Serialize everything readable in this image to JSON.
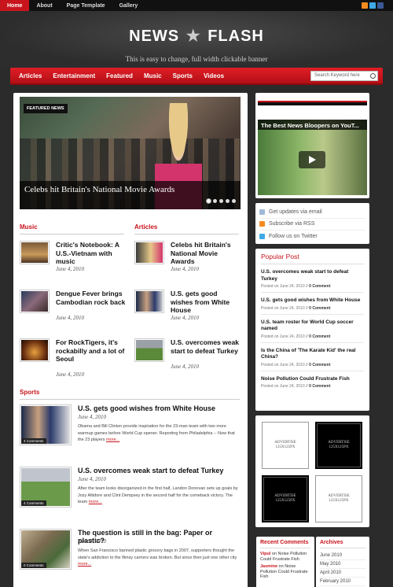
{
  "topnav": {
    "items": [
      "Home",
      "About",
      "Page Template",
      "Gallery"
    ],
    "social": [
      {
        "name": "rss-icon",
        "color": "#f58b1f"
      },
      {
        "name": "twitter-icon",
        "color": "#3fa9e6"
      },
      {
        "name": "facebook-icon",
        "color": "#3b5998"
      }
    ]
  },
  "header": {
    "logo_left": "NEWS",
    "logo_right": "FLASH",
    "tagline": "This is easy to change, full width clickable banner"
  },
  "menu": {
    "items": [
      "Articles",
      "Entertainment",
      "Featured",
      "Music",
      "Sports",
      "Videos"
    ],
    "search_placeholder": "Search Keyword here"
  },
  "featured": {
    "label": "FEATURED NEWS",
    "caption": "Celebs hit Britain's National Movie Awards"
  },
  "music": {
    "title": "Music",
    "items": [
      {
        "title": "Critic's Notebook: A U.S.-Vietnam with music",
        "date": "June 4, 2010"
      },
      {
        "title": "Dengue Fever brings Cambodian rock back",
        "date": "June 4, 2010"
      },
      {
        "title": "For RockTigers, it's rockabilly and a lot of Seoul",
        "date": "June 4, 2010"
      }
    ]
  },
  "articles": {
    "title": "Articles",
    "items": [
      {
        "title": "Celebs hit Britain's National Movie Awards",
        "date": "June 4, 2010"
      },
      {
        "title": "U.S. gets good wishes from White House",
        "date": "June 4, 2010"
      },
      {
        "title": "U.S. overcomes weak start to defeat Turkey",
        "date": "June 4, 2010"
      }
    ]
  },
  "sports": {
    "title": "Sports",
    "items": [
      {
        "title": "U.S. gets good wishes from White House",
        "date": "June 4, 2010",
        "comments": "4 Comments",
        "excerpt": "Obama and Bill Clinton provide inspiration for the 23-man team with two more warmup games before World Cup opener. Reporting from Philadelphia -- Now that the 23 players",
        "more": "more..."
      },
      {
        "title": "U.S. overcomes weak start to defeat Turkey",
        "date": "June 4, 2010",
        "comments": "4 Comments",
        "excerpt": "After the team looks disorganized in the first half, Landon Donovan sets up goals by Jozy Altidore and Clint Dempsey in the second half for the comeback victory. The team",
        "more": "more..."
      },
      {
        "title": "The question is still in the bag: Paper or plastic?",
        "date": "June 4, 2010",
        "comments": "0 Comments",
        "excerpt": "When San Francisco banned plastic grocery bags in 2007, supporters thought the state's addiction to the flimsy carriers was broken. But since then just one other city",
        "more": "more..."
      }
    ]
  },
  "video": {
    "title": "The Best News Bloopers on YouT..."
  },
  "subscribe": {
    "items": [
      {
        "label": "Get updates via email",
        "icon": "email-icon",
        "color": "#9fb9d6"
      },
      {
        "label": "Subscribe via RSS",
        "icon": "rss-icon",
        "color": "#f58b1f"
      },
      {
        "label": "Follow us on Twitter",
        "icon": "twitter-icon",
        "color": "#3fa9e6"
      }
    ]
  },
  "popular": {
    "title": "Popular Post",
    "items": [
      {
        "title": "U.S. overcomes weak start to defeat Turkey",
        "posted": "Posted on June 24, 2010",
        "comments": "0 Comment"
      },
      {
        "title": "U.S. gets good wishes from White House",
        "posted": "Posted on June 24, 2010",
        "comments": "0 Comment"
      },
      {
        "title": "U.S. team roster for World Cup soccer named",
        "posted": "Posted on June 24, 2010",
        "comments": "0 Comment"
      },
      {
        "title": "Is the China of 'The Karate Kid' the real China?",
        "posted": "Posted on June 24, 2010",
        "comments": "0 Comment"
      },
      {
        "title": "Noise Pollution Could Frustrate Fish",
        "posted": "Posted on June 24, 2010",
        "comments": "0 Comment"
      }
    ]
  },
  "ads": [
    {
      "line1": "ADVERTISE",
      "line2": "125X125PX",
      "style": "light"
    },
    {
      "line1": "ADVERTISE",
      "line2": "125X125PX",
      "style": "dark"
    },
    {
      "line1": "ADVERTISE",
      "line2": "125X125PX",
      "style": "dark"
    },
    {
      "line1": "ADVERTISE",
      "line2": "125X125PX",
      "style": "light"
    }
  ],
  "recent_comments": {
    "title": "Recent Comments",
    "items": [
      {
        "author": "Vipul",
        "text": "on Noise Pollution Could Frustrate Fish"
      },
      {
        "author": "Jasmine",
        "text": "on Noise Pollution Could Frustrate Fish"
      }
    ]
  },
  "archives": {
    "title": "Archives",
    "items": [
      "June 2010",
      "May 2010",
      "April 2010",
      "February 2010"
    ]
  },
  "colors": {
    "accent": "#c8141c",
    "background": "#2b2b2b"
  }
}
